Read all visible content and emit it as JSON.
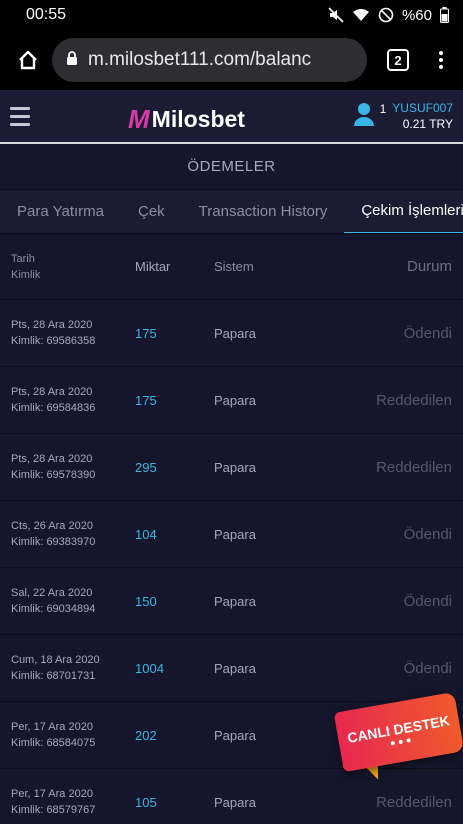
{
  "status_bar": {
    "time": "00:55",
    "battery": "%60",
    "icons": [
      "mute-icon",
      "wifi-icon",
      "do-not-disturb-icon",
      "battery-icon"
    ]
  },
  "browser": {
    "url": "m.milosbet111.com/balanc",
    "tab_count": "2",
    "icons": [
      "home-icon",
      "lock-icon",
      "tabs-icon",
      "more-vert-icon"
    ]
  },
  "site_header": {
    "logo_text": "Milosbet",
    "logo_mark": "M",
    "user_count": "1",
    "username": "YUSUF007",
    "balance": "0.21 TRY",
    "accent_color": "#38b5e6"
  },
  "page_title": "ÖDEMELER",
  "tabs": [
    {
      "label": "Para Yatırma"
    },
    {
      "label": "Çek"
    },
    {
      "label": "Transaction History"
    },
    {
      "label": "Çekim İşlemleri"
    }
  ],
  "table": {
    "headers": {
      "date": "Tarih",
      "id": "Kimlik",
      "amount": "Miktar",
      "system": "Sistem",
      "status": "Durum"
    },
    "rows": [
      {
        "date": "Pts, 28 Ara 2020",
        "id": "Kimlik: 69586358",
        "amount": "175",
        "system": "Papara",
        "status": "Ödendi"
      },
      {
        "date": "Pts, 28 Ara 2020",
        "id": "Kimlik: 69584836",
        "amount": "175",
        "system": "Papara",
        "status": "Reddedilen"
      },
      {
        "date": "Pts, 28 Ara 2020",
        "id": "Kimlik: 69578390",
        "amount": "295",
        "system": "Papara",
        "status": "Reddedilen"
      },
      {
        "date": "Cts, 26 Ara 2020",
        "id": "Kimlik: 69383970",
        "amount": "104",
        "system": "Papara",
        "status": "Ödendi"
      },
      {
        "date": "Sal, 22 Ara 2020",
        "id": "Kimlik: 69034894",
        "amount": "150",
        "system": "Papara",
        "status": "Ödendi"
      },
      {
        "date": "Cum, 18 Ara 2020",
        "id": "Kimlik: 68701731",
        "amount": "1004",
        "system": "Papara",
        "status": "Ödendi"
      },
      {
        "date": "Per, 17 Ara 2020",
        "id": "Kimlik: 68584075",
        "amount": "202",
        "system": "Papara",
        "status": ""
      },
      {
        "date": "Per, 17 Ara 2020",
        "id": "Kimlik: 68579767",
        "amount": "105",
        "system": "Papara",
        "status": "Reddedilen"
      }
    ]
  },
  "live_support": {
    "label": "CANLI DESTEK"
  }
}
